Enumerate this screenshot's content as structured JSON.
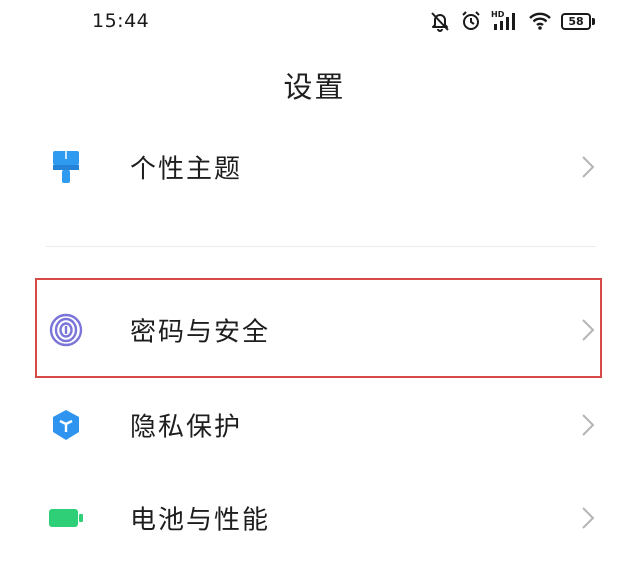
{
  "status_bar": {
    "time": "15:44",
    "icons": [
      "bell-muted-icon",
      "alarm-clock-icon",
      "hd-signal-icon",
      "wifi-icon"
    ],
    "hd_label": "HD",
    "battery": "58"
  },
  "header": {
    "title": "设置"
  },
  "settings": {
    "items": [
      {
        "label": "个性主题",
        "icon": "theme-brush-icon",
        "color": "#2f9bf0"
      },
      {
        "label": "密码与安全",
        "icon": "fingerprint-icon",
        "color": "#7b74d9"
      },
      {
        "label": "隐私保护",
        "icon": "privacy-shield-icon",
        "color": "#2f94f0"
      },
      {
        "label": "电池与性能",
        "icon": "battery-icon",
        "color": "#2ecf77"
      }
    ]
  },
  "colors": {
    "highlight_border": "#d64a4a",
    "chevron": "#b5b5b5"
  }
}
